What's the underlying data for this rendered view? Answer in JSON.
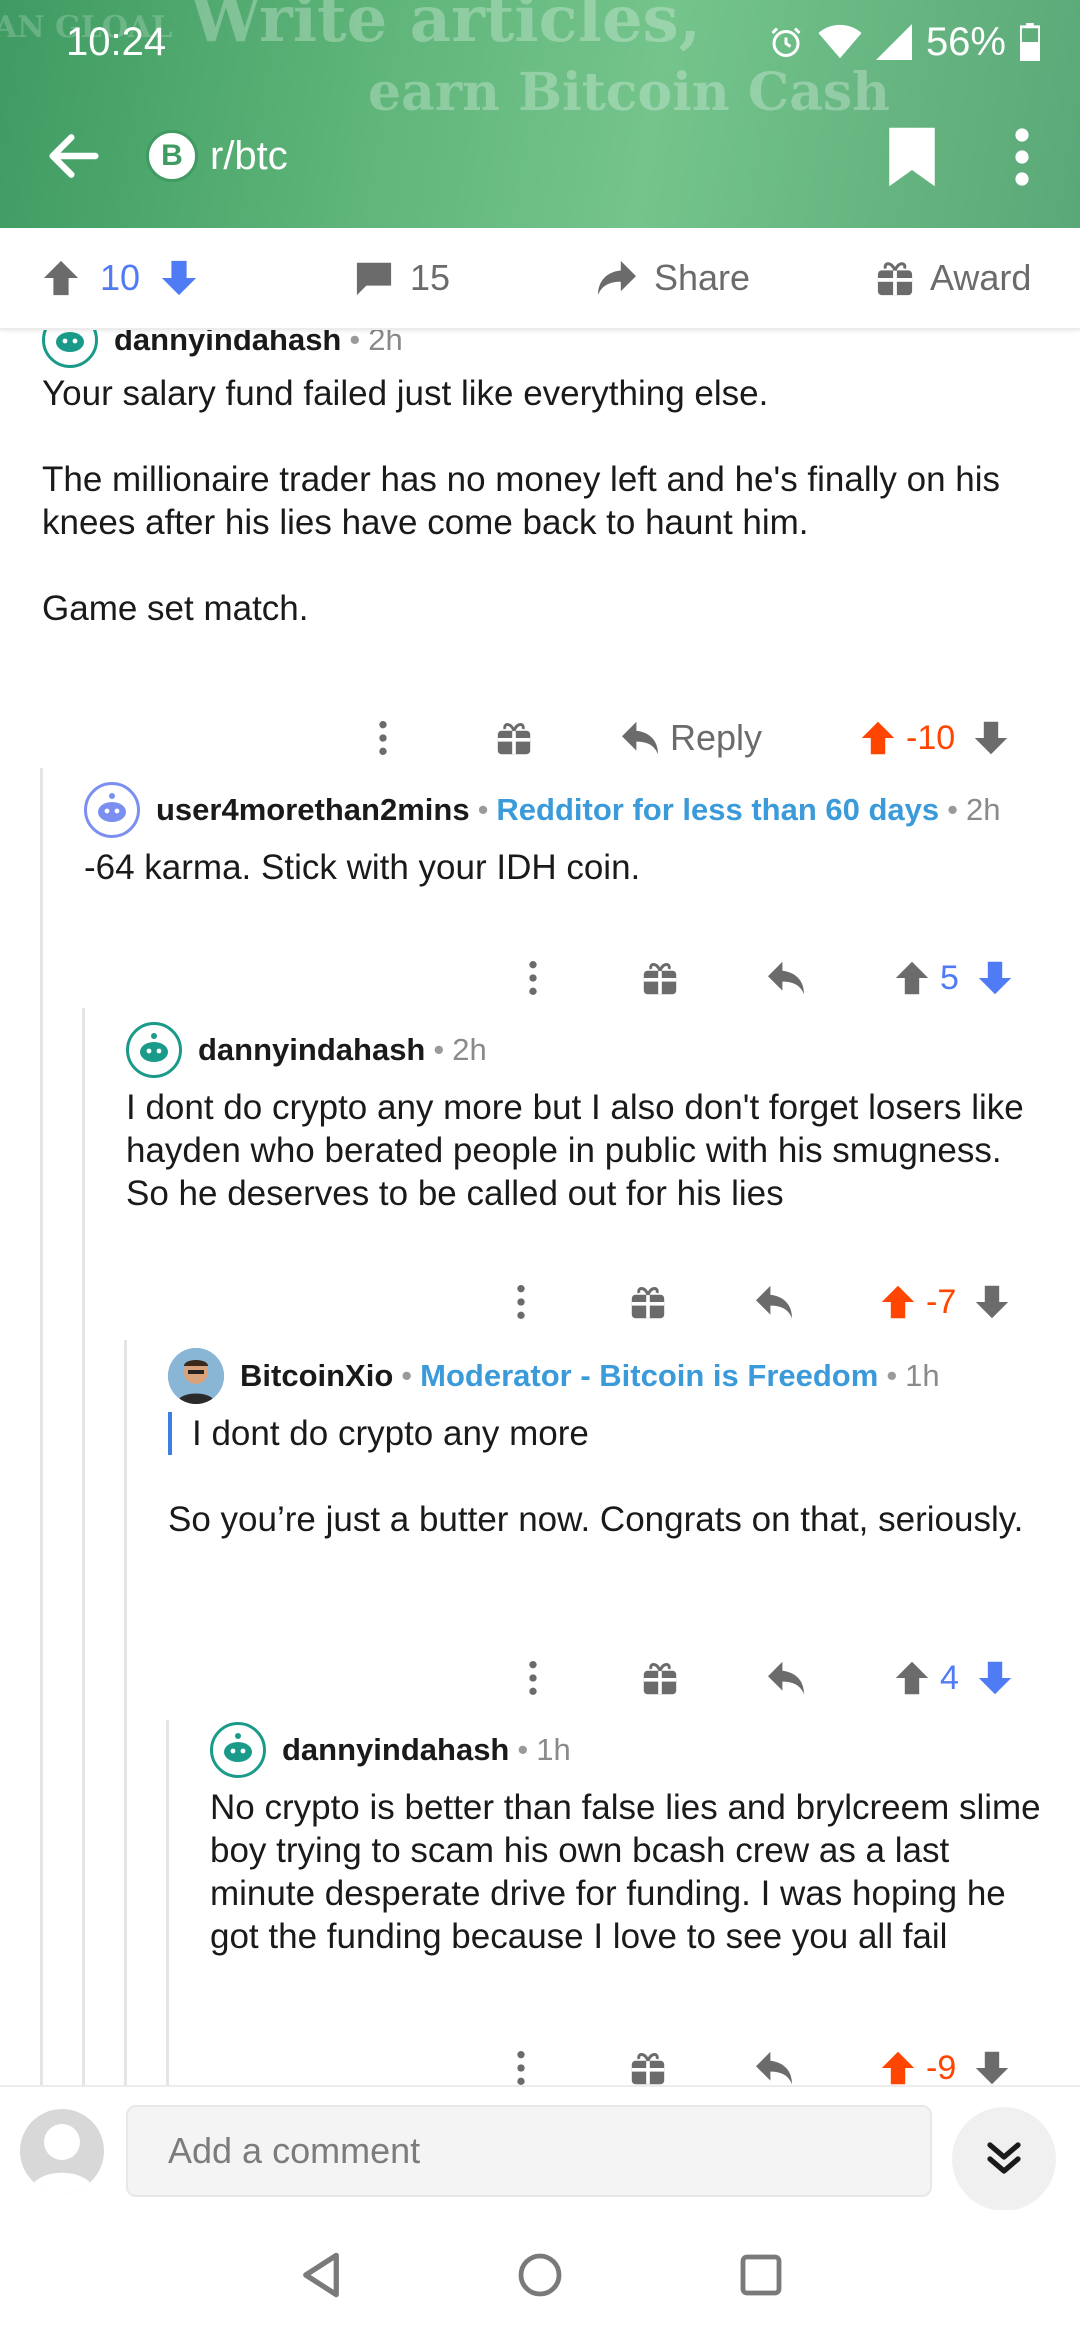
{
  "status_bar": {
    "time": "10:24",
    "battery": "56%"
  },
  "header": {
    "banner_line1": "Write articles,",
    "banner_line2": "earn Bitcoin Cash",
    "banner_tag": "AN GLOAL",
    "subreddit": "r/btc",
    "subreddit_icon_letter": "B",
    "brand_color": "#3f9b62"
  },
  "action_bar": {
    "votes": "10",
    "comments": "15",
    "share_label": "Share",
    "award_label": "Award"
  },
  "comments": [
    {
      "author": "dannyindahash",
      "flair": "",
      "time": "2h",
      "paragraphs": [
        "Your salary fund failed just like everything else.",
        "The millionaire trader has no money left and he's finally on his knees after his lies have come back to haunt him.",
        "Game set match."
      ],
      "reply_label": "Reply",
      "score": "-10",
      "vote_state": "upvoted"
    },
    {
      "author": "user4morethan2mins",
      "flair": "Redditor for less than 60 days",
      "time": "2h",
      "paragraphs": [
        "-64 karma. Stick with your IDH coin."
      ],
      "score": "5",
      "vote_state": "none"
    },
    {
      "author": "dannyindahash",
      "flair": "",
      "time": "2h",
      "paragraphs": [
        "I dont do crypto any more but I also don't forget losers like hayden who berated people in public with his smugness. So he deserves to be called out for his lies"
      ],
      "score": "-7",
      "vote_state": "upvoted"
    },
    {
      "author": "BitcoinXio",
      "flair": "Moderator - Bitcoin is Freedom",
      "time": "1h",
      "quote": "I dont do crypto any more",
      "paragraphs": [
        "So you’re just a butter now. Congrats on that, seriously."
      ],
      "score": "4",
      "vote_state": "none"
    },
    {
      "author": "dannyindahash",
      "flair": "",
      "time": "1h",
      "paragraphs": [
        "No crypto is better than false lies and brylcreem slime boy trying to scam his own bcash crew as a last minute desperate drive for funding. I was hoping he got the funding because I love to see you all fail"
      ],
      "score": "-9",
      "vote_state": "upvoted"
    }
  ],
  "comment_bar": {
    "placeholder": "Add a comment"
  },
  "colors": {
    "upvote": "#ff4500",
    "downvote": "#4f7bf5",
    "flair": "#3b9ad9",
    "quote_bar": "#3b7fe0"
  }
}
